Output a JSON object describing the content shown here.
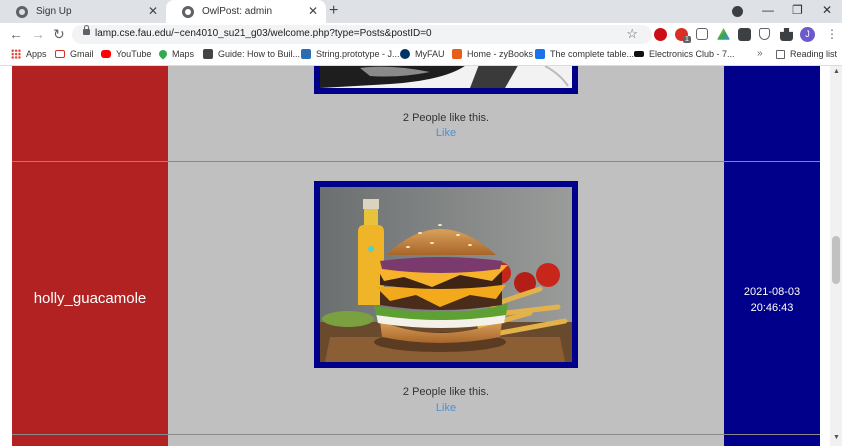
{
  "tabs": [
    {
      "title": "Sign Up"
    },
    {
      "title": "OwlPost: admin"
    }
  ],
  "address_bar": {
    "url": "lamp.cse.fau.edu/~cen4010_su21_g03/welcome.php?type=Posts&postID=0"
  },
  "toolbar": {
    "avatar_letter": "J",
    "ext_badge": "1"
  },
  "bookmarks": [
    {
      "label": "Apps",
      "icon": "apps-grid-icon",
      "color": "#e94235"
    },
    {
      "label": "Gmail",
      "icon": "gmail-icon",
      "color": "#d93025"
    },
    {
      "label": "YouTube",
      "icon": "youtube-icon",
      "color": "#ff0000"
    },
    {
      "label": "Maps",
      "icon": "maps-icon",
      "color": "#34a853"
    },
    {
      "label": "Guide: How to Buil...",
      "icon": "guide-icon",
      "color": "#444444"
    },
    {
      "label": "String.prototype - J...",
      "icon": "mdn-icon",
      "color": "#2a6db3"
    },
    {
      "label": "MyFAU",
      "icon": "myfau-icon",
      "color": "#003366"
    },
    {
      "label": "Home - zyBooks",
      "icon": "zybooks-icon",
      "color": "#e85d1a"
    },
    {
      "label": "The complete table...",
      "icon": "bookmark-icon",
      "color": "#1a73e8"
    },
    {
      "label": "Electronics Club - 7...",
      "icon": "club-icon",
      "color": "#111111"
    },
    {
      "label": "Reading list",
      "icon": "reading-list-icon",
      "color": "#5f6368"
    }
  ],
  "posts": [
    {
      "likes_text": "2 People like this.",
      "like_label": "Like"
    },
    {
      "username": "holly_guacamole",
      "date": "2021-08-03",
      "time": "20:46:43",
      "likes_text": "2 People like this.",
      "like_label": "Like"
    }
  ],
  "colors": {
    "user_col": "#b22222",
    "content_col": "#c0c0c0",
    "date_col": "#00008b",
    "like_link": "#4a90d9"
  }
}
